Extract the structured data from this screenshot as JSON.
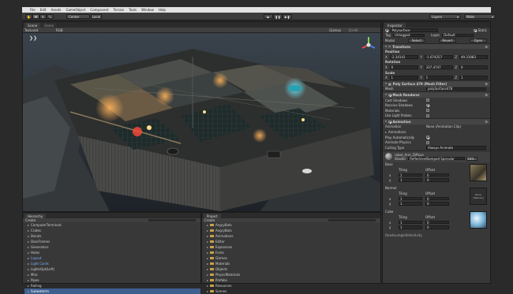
{
  "menu": [
    "File",
    "Edit",
    "Assets",
    "GameObject",
    "Component",
    "Terrain",
    "Tools",
    "Window",
    "Help"
  ],
  "toolbar": {
    "pivot_label": "Center",
    "space_label": "Local",
    "layers_label": "Layers",
    "layout_label": "Wide"
  },
  "scene_tabs": {
    "scene": "Scene",
    "game": "Game"
  },
  "scene_bar": {
    "render_mode": "Textured",
    "color_mode": "RGB",
    "gizmos_label": "Gizmos",
    "search_placeholder": "Q+All"
  },
  "hierarchy": {
    "tab": "Hierarchy",
    "create": "Create",
    "items": [
      {
        "label": "ComputerTerminals",
        "style": "normal"
      },
      {
        "label": "Crates",
        "style": "normal"
      },
      {
        "label": "Decals",
        "style": "normal"
      },
      {
        "label": "DoorFrames",
        "style": "normal"
      },
      {
        "label": "Generators",
        "style": "normal"
      },
      {
        "label": "Holes",
        "style": "normal"
      },
      {
        "label": "Layout",
        "style": "blue"
      },
      {
        "label": "Light Cards",
        "style": "blue"
      },
      {
        "label": "LightsOpt(Left)",
        "style": "normal"
      },
      {
        "label": "Misc",
        "style": "normal"
      },
      {
        "label": "Pipes",
        "style": "normal"
      },
      {
        "label": "Railing",
        "style": "normal"
      },
      {
        "label": "Subwaterm",
        "style": "selected"
      }
    ]
  },
  "project": {
    "tab": "Project",
    "create": "Create",
    "folders": [
      "AngryBots",
      "AngryBots",
      "Animations",
      "Editor",
      "Explosions",
      "Fonts",
      "Gizmos",
      "Materials",
      "Objects",
      "PhysicMaterials",
      "Prefabs",
      "Resources",
      "Scenes"
    ]
  },
  "inspector": {
    "tab": "Inspector",
    "object_name": "Polysurface",
    "static_label": "Static",
    "tag_label": "Tag",
    "tag_value": "Untagged",
    "layer_label": "Layer",
    "layer_value": "Default",
    "prefab_labels": [
      "Model",
      "Select",
      "Revert",
      "Open"
    ],
    "transform": {
      "title": "Transform",
      "position_label": "Position",
      "position": [
        "-2.34141",
        "-1.074257",
        "49.31083"
      ],
      "rotation_label": "Rotation",
      "rotation": [
        "0",
        "337.4747",
        "0"
      ],
      "scale_label": "Scale",
      "scale": [
        "1",
        "1",
        "1"
      ]
    },
    "mesh_filter": {
      "title": "Poly Surface 479 (Mesh Filter)",
      "mesh_label": "Mesh",
      "mesh_value": "polySurface478"
    },
    "mesh_renderer": {
      "title": "Mesh Renderer",
      "rows": [
        {
          "label": "Cast Shadows",
          "checked": false
        },
        {
          "label": "Receive Shadows",
          "checked": true
        },
        {
          "label": "Materials",
          "checked": false
        },
        {
          "label": "Use Light Probes",
          "checked": false
        }
      ]
    },
    "animation": {
      "title": "Animation",
      "animation_label": "Animation",
      "animation_value": "None (Animation Clip)",
      "animations_label": "Animations",
      "play_auto_label": "Play Automatically",
      "animate_physics_label": "Animate Physics",
      "culling_label": "Culling Type",
      "culling_value": "Always Animate"
    },
    "material": {
      "name": "robot_Arm_Diffuse",
      "shader_label": "Shader",
      "shader_value": "Reflective/Bumped Specular",
      "edit_label": "Edit...",
      "base_label": "Base",
      "normal_label": "Normal",
      "cube_label": "Cube",
      "tiling_label": "Tiling",
      "offset_label": "Offset",
      "x_label": "x",
      "y_label": "y",
      "tiling_value": "1",
      "offset_value": "0",
      "normal_thumb_note": "None (Texture)",
      "select_label": "Select",
      "footer_label": "DeadnumgleRefectivity"
    }
  },
  "colors": {
    "accent": "#3f5f8f",
    "play_blue": "#7eb0ff",
    "folder": "#c9a24a"
  }
}
